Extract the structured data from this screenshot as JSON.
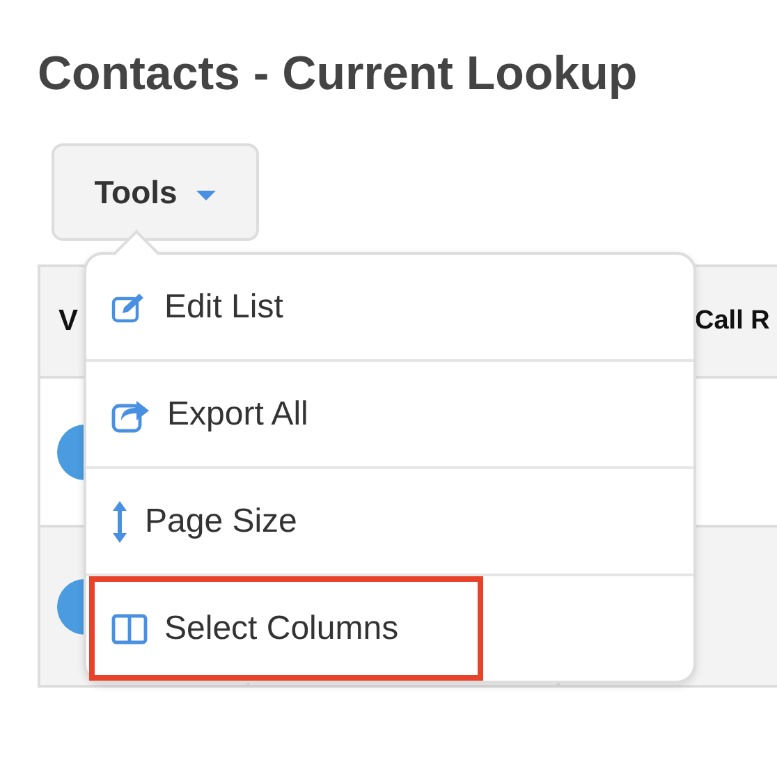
{
  "title": "Contacts - Current Lookup",
  "tools_button": {
    "label": "Tools",
    "expanded": true
  },
  "table": {
    "columns": [
      "V",
      "Call R"
    ],
    "rows": [
      {
        "avatar": true
      },
      {
        "avatar": true
      }
    ]
  },
  "menu": {
    "items": [
      {
        "label": "Edit List",
        "kind": "edit",
        "highlighted": false
      },
      {
        "label": "Export All",
        "kind": "share",
        "highlighted": false
      },
      {
        "label": "Page Size",
        "kind": "resize",
        "highlighted": false
      },
      {
        "label": "Select Columns",
        "kind": "columns",
        "highlighted": true
      }
    ]
  }
}
